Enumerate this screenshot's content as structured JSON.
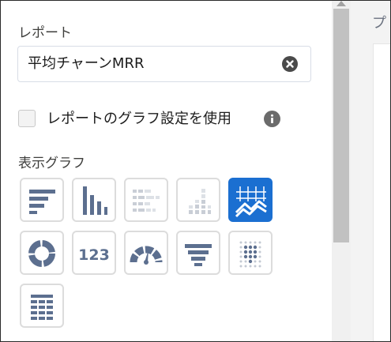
{
  "panel": {
    "report_label": "レポート",
    "report_value": "平均チャーンMRR",
    "use_report_chart_label": "レポートのグラフ設定を使用",
    "use_report_chart_checked": false,
    "chart_section_label": "表示グラフ"
  },
  "preview": {
    "label_partial": "プ"
  },
  "chart_types": [
    {
      "icon": "horizontal-bar-chart-icon",
      "enabled": true,
      "selected": false
    },
    {
      "icon": "vertical-bar-chart-icon",
      "enabled": true,
      "selected": false
    },
    {
      "icon": "stacked-horizontal-bar-chart-icon",
      "enabled": false,
      "selected": false
    },
    {
      "icon": "stacked-vertical-bar-chart-icon",
      "enabled": false,
      "selected": false
    },
    {
      "icon": "line-chart-icon",
      "enabled": true,
      "selected": true
    },
    {
      "icon": "donut-chart-icon",
      "enabled": true,
      "selected": false
    },
    {
      "icon": "metric-icon",
      "enabled": true,
      "selected": false,
      "text": "123"
    },
    {
      "icon": "gauge-icon",
      "enabled": true,
      "selected": false
    },
    {
      "icon": "funnel-chart-icon",
      "enabled": true,
      "selected": false
    },
    {
      "icon": "scatter-chart-icon",
      "enabled": true,
      "selected": false
    },
    {
      "icon": "table-icon",
      "enabled": true,
      "selected": false
    }
  ],
  "colors": {
    "icon": "#5c6f8f",
    "icon_disabled": "#c9ced6",
    "selected_bg": "#1b6fd1",
    "selected_icon": "#ffffff"
  }
}
